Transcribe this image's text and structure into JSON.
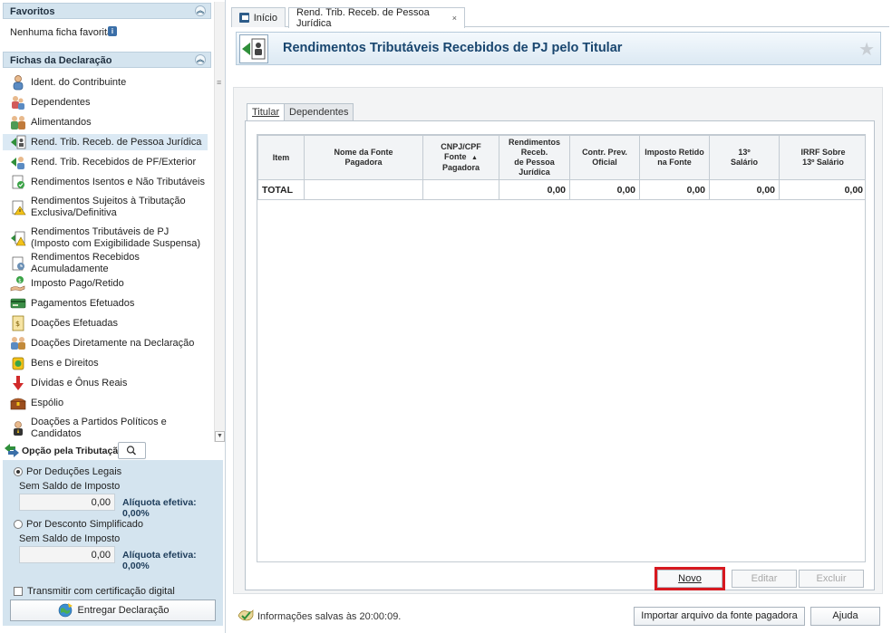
{
  "sidebar": {
    "favoritos": {
      "title": "Favoritos",
      "empty_text": "Nenhuma ficha favorita"
    },
    "fichas": {
      "title": "Fichas da Declaração",
      "items": [
        {
          "label": "Ident. do Contribuinte",
          "icon": "person-icon",
          "selected": false
        },
        {
          "label": "Dependentes",
          "icon": "dependents-icon",
          "selected": false
        },
        {
          "label": "Alimentandos",
          "icon": "alimentandos-icon",
          "selected": false
        },
        {
          "label": "Rend. Trib. Receb. de Pessoa Jurídica",
          "icon": "income-pj-icon",
          "selected": true
        },
        {
          "label": "Rend. Trib. Recebidos de PF/Exterior",
          "icon": "income-pf-icon",
          "selected": false
        },
        {
          "label": "Rendimentos Isentos e Não Tributáveis",
          "icon": "exempt-income-icon",
          "selected": false
        },
        {
          "label": "Rendimentos Sujeitos à Tributação Exclusiva/Definitiva",
          "icon": "warning-doc-icon",
          "selected": false
        },
        {
          "label": "Rendimentos Tributáveis de PJ (Imposto com Exigibilidade Suspensa)",
          "icon": "suspended-tax-icon",
          "selected": false
        },
        {
          "label": "Rendimentos Recebidos Acumuladamente",
          "icon": "accumulated-income-icon",
          "selected": false
        },
        {
          "label": "Imposto Pago/Retido",
          "icon": "tax-paid-icon",
          "selected": false
        },
        {
          "label": "Pagamentos Efetuados",
          "icon": "payment-card-icon",
          "selected": false
        },
        {
          "label": "Doações Efetuadas",
          "icon": "donation-doc-icon",
          "selected": false
        },
        {
          "label": "Doações Diretamente na Declaração",
          "icon": "donation-people-icon",
          "selected": false
        },
        {
          "label": "Bens e Direitos",
          "icon": "assets-icon",
          "selected": false
        },
        {
          "label": "Dívidas e Ônus Reais",
          "icon": "debts-arrow-icon",
          "selected": false
        },
        {
          "label": "Espólio",
          "icon": "treasure-chest-icon",
          "selected": false
        },
        {
          "label": "Doações a Partidos Políticos e Candidatos",
          "icon": "politician-icon",
          "selected": false
        }
      ]
    },
    "opcao": {
      "label": "Opção pela Tributação:"
    },
    "tributacao": {
      "legais": {
        "label": "Por Deduções Legais",
        "selected": true,
        "saldo_label": "Sem Saldo de Imposto",
        "value": "0,00",
        "aliquota": "Alíquota efetiva: 0,00%"
      },
      "simplificado": {
        "label": "Por Desconto Simplificado",
        "selected": false,
        "saldo_label": "Sem Saldo de Imposto",
        "value": "0,00",
        "aliquota": "Alíquota efetiva: 0,00%"
      },
      "cert_label": "Transmitir com certificação digital",
      "entregar_label": "Entregar Declaração"
    }
  },
  "tabs": [
    {
      "label": "Início"
    },
    {
      "label": "Rend. Trib. Receb. de Pessoa Jurídica",
      "close": "×"
    }
  ],
  "page": {
    "title": "Rendimentos Tributáveis Recebidos de PJ pelo Titular",
    "subtabs": [
      "Titular",
      "Dependentes"
    ]
  },
  "table": {
    "headers": [
      [
        "Item"
      ],
      [
        "Nome da Fonte",
        "Pagadora"
      ],
      [
        "CNPJ/CPF",
        "Fonte",
        "Pagadora"
      ],
      [
        "Rendimentos",
        "Receb.",
        "de Pessoa",
        "Jurídica"
      ],
      [
        "Contr. Prev.",
        "Oficial"
      ],
      [
        "Imposto Retido",
        "na Fonte"
      ],
      [
        "13º",
        "Salário"
      ],
      [
        "IRRF Sobre",
        "13º Salário"
      ]
    ],
    "total_row": [
      "TOTAL",
      "",
      "",
      "0,00",
      "0,00",
      "0,00",
      "0,00",
      "0,00"
    ]
  },
  "actions": {
    "novo": "Novo",
    "editar": "Editar",
    "excluir": "Excluir"
  },
  "status": {
    "text": "Informações salvas às 20:00:09.",
    "importar_label": "Importar arquivo da fonte pagadora",
    "ajuda_label": "Ajuda"
  },
  "colors": {
    "accent": "#19466f",
    "highlight_border": "#d71920",
    "panel_blue": "#d4e4ef",
    "selected_item": "#dbe9f4"
  }
}
